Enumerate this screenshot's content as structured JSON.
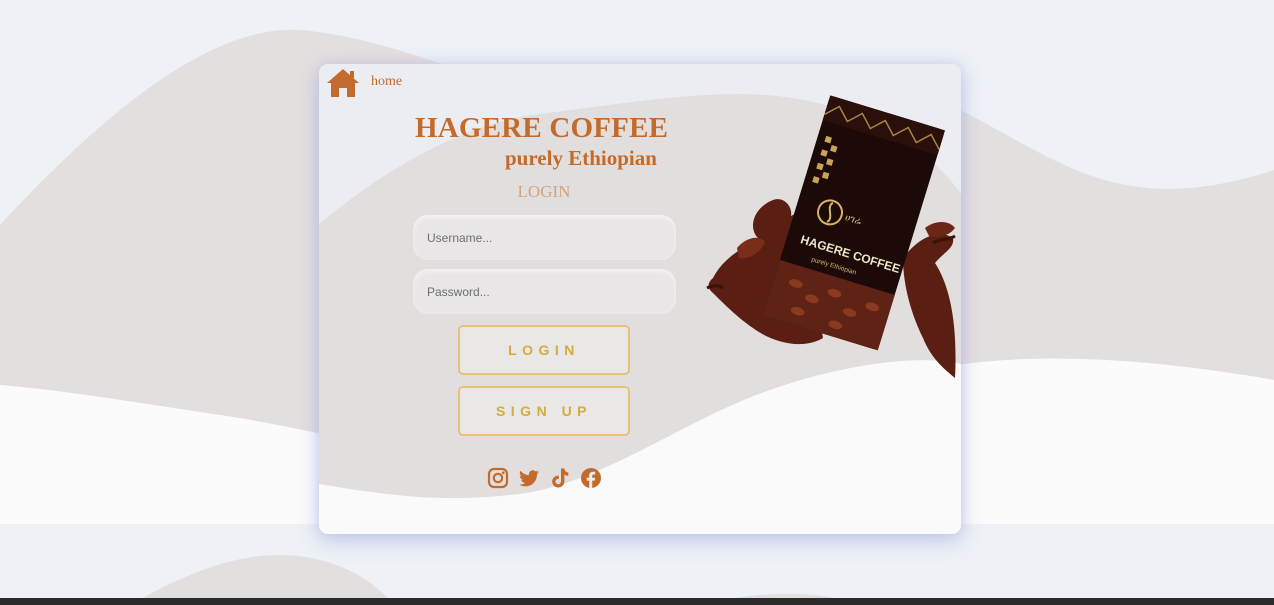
{
  "nav": {
    "home_label": "home"
  },
  "brand": {
    "title": "HAGERE COFFEE",
    "tagline": "purely Ethiopian"
  },
  "form": {
    "heading": "LOGIN",
    "username_placeholder": "Username...",
    "password_placeholder": "Password...",
    "login_label": "LOGIN",
    "signup_label": "SIGN UP"
  },
  "socials": [
    "instagram-icon",
    "twitter-icon",
    "tiktok-icon",
    "facebook-icon"
  ],
  "product_image": {
    "bag_brand_text": "HAGERE COFFEE",
    "bag_tagline_text": "purely Ethiopian"
  },
  "colors": {
    "accent": "#c46a2b",
    "button_border": "#e9c07a",
    "button_text": "#d4ac3a",
    "page_bg": "#eef1f6",
    "wave": "#e3dfdf"
  }
}
